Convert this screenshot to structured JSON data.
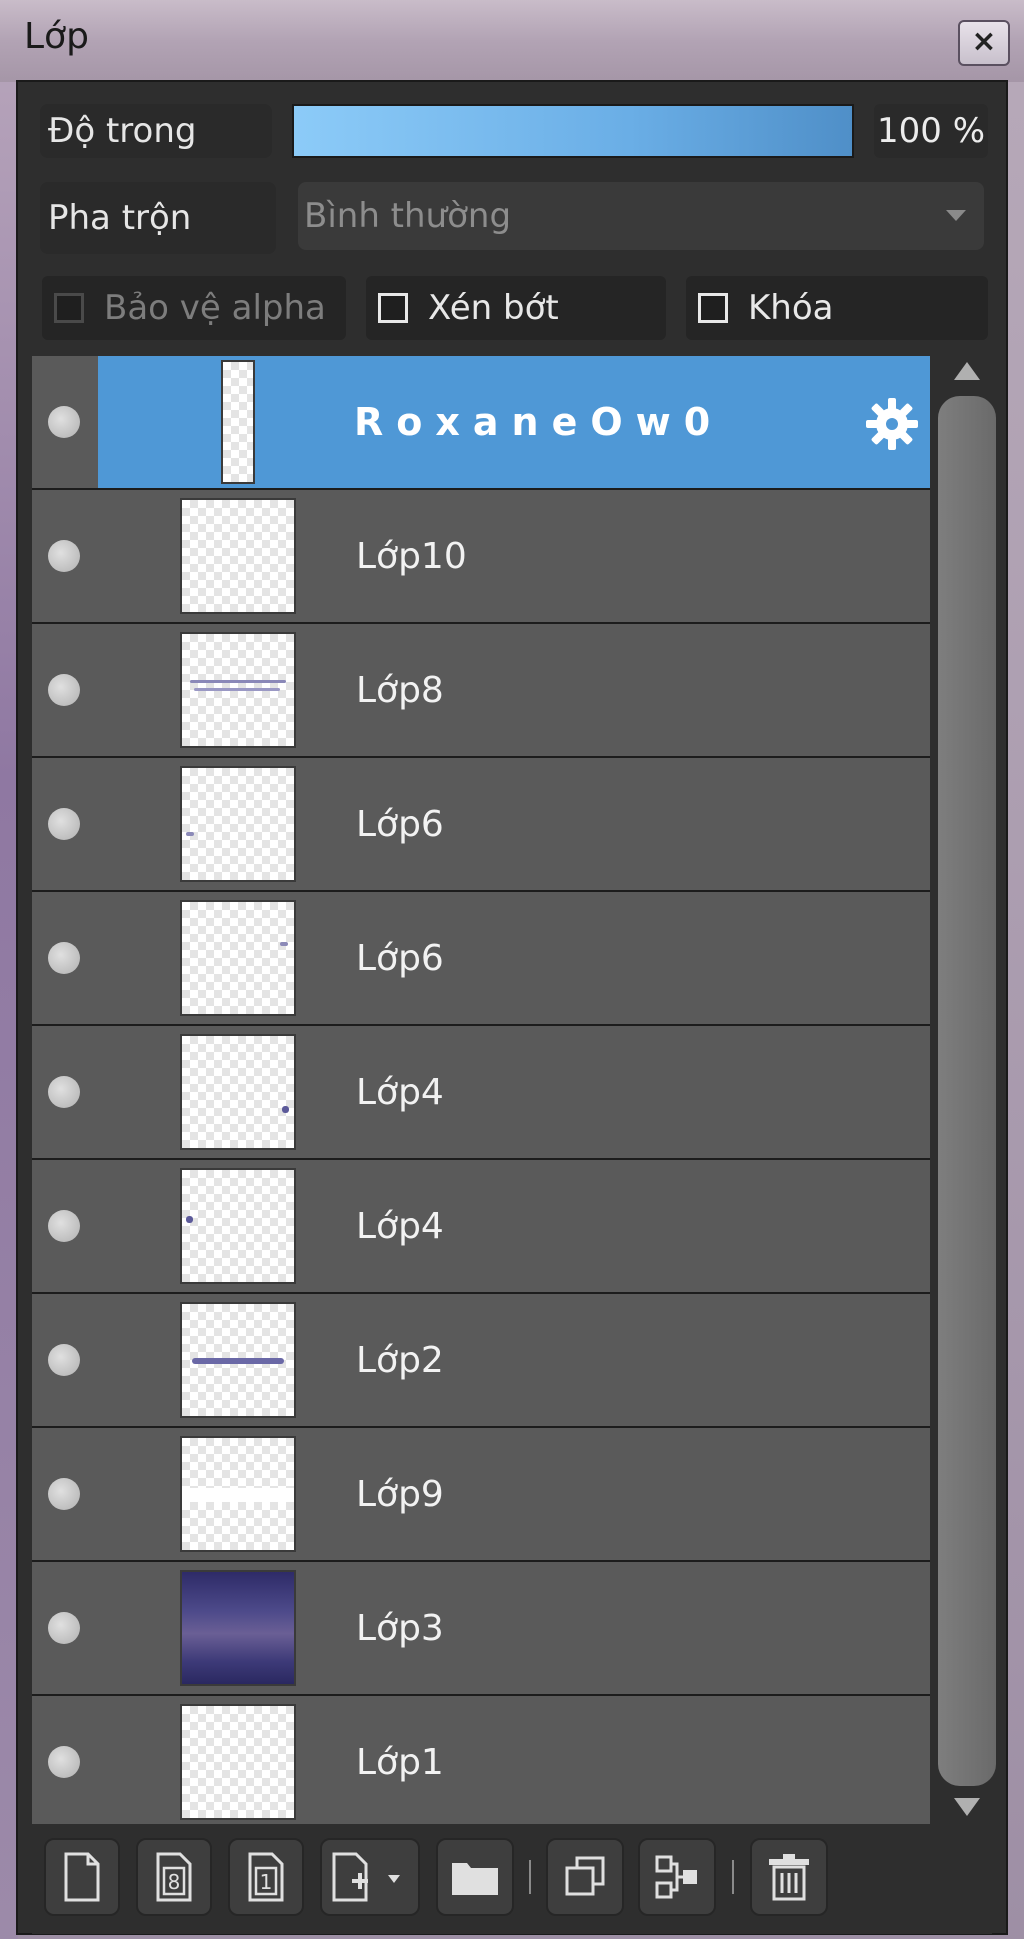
{
  "window": {
    "title": "Lớp",
    "close_label": "×"
  },
  "controls": {
    "opacity_label": "Độ trong",
    "opacity_value": "100 %",
    "opacity_level": 1.0,
    "blend_label": "Pha trộn",
    "blend_value": "Bình thường",
    "alpha_protect_label": "Bảo vệ alpha",
    "clip_label": "Xén bớt",
    "lock_label": "Khóa"
  },
  "layers": [
    {
      "name": "RoxaneOw0",
      "selected": true,
      "thumb": "tall"
    },
    {
      "name": "Lớp10",
      "thumb": "blank"
    },
    {
      "name": "Lớp8",
      "thumb": "text"
    },
    {
      "name": "Lớp6",
      "thumb": "dot-left"
    },
    {
      "name": "Lớp6",
      "thumb": "dot-right"
    },
    {
      "name": "Lớp4",
      "thumb": "dot-bottom-right"
    },
    {
      "name": "Lớp4",
      "thumb": "dot-top-left"
    },
    {
      "name": "Lớp2",
      "thumb": "text2"
    },
    {
      "name": "Lớp9",
      "thumb": "blank"
    },
    {
      "name": "Lớp3",
      "thumb": "sky"
    },
    {
      "name": "Lớp1",
      "thumb": "blank"
    }
  ],
  "toolbar": {
    "new_layer_icon": "new-page-icon",
    "layer_8bit_icon": "layer-8bit-icon",
    "layer_1bit_icon": "layer-1bit-icon",
    "add_menu_icon": "add-layer-menu-icon",
    "folder_icon": "folder-icon",
    "duplicate_icon": "duplicate-icon",
    "merge_icon": "merge-icon",
    "delete_icon": "trash-icon",
    "counter_8": "8",
    "counter_1": "1"
  },
  "colors": {
    "selected_row": "#4f98d6",
    "row": "#5a5a5a",
    "panel": "#2e2e2e"
  }
}
